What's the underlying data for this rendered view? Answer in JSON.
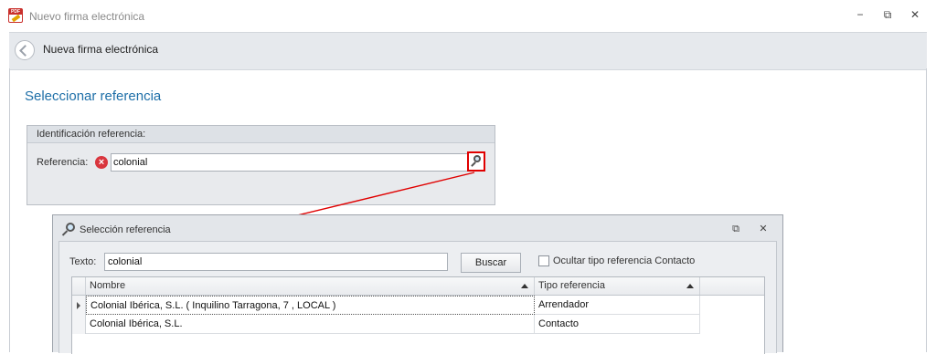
{
  "window": {
    "title": "Nuevo firma electrónica",
    "controls": {
      "minimize": "−",
      "restore": "⧉",
      "close": "✕"
    }
  },
  "navbar": {
    "title": "Nueva firma electrónica"
  },
  "section": {
    "title": "Seleccionar referencia"
  },
  "identification": {
    "header": "Identificación referencia:",
    "label": "Referencia:",
    "value": "colonial"
  },
  "dialog": {
    "title": "Selección referencia",
    "controls": {
      "restore": "⧉",
      "close": "✕"
    },
    "search_label": "Texto:",
    "search_value": "colonial",
    "search_button": "Buscar",
    "hide_checkbox_label": "Ocultar tipo referencia Contacto",
    "hide_checkbox_checked": false,
    "grid": {
      "columns": [
        "Nombre",
        "Tipo referencia"
      ],
      "rows": [
        {
          "nombre": "Colonial Ibérica, S.L. ( Inquilino Tarragona, 7 , LOCAL )",
          "tipo": "Arrendador",
          "active": true
        },
        {
          "nombre": "Colonial Ibérica, S.L.",
          "tipo": "Contacto",
          "active": false
        }
      ]
    }
  },
  "colors": {
    "accent": "#1e6fa8",
    "highlight": "#e00000",
    "error": "#d9363e"
  }
}
